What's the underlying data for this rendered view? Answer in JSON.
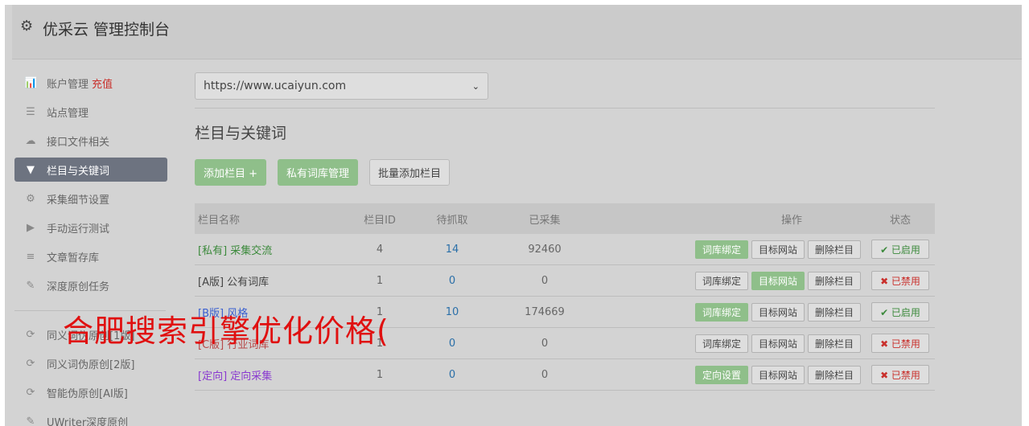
{
  "header": {
    "title": "优采云 管理控制台",
    "icon": "gear-icon"
  },
  "sidebar": {
    "items": [
      {
        "label": "账户管理",
        "extra": "充值",
        "icon": "bar-chart-icon",
        "glyph": "📊"
      },
      {
        "label": "站点管理",
        "icon": "server-icon",
        "glyph": "☰"
      },
      {
        "label": "接口文件相关",
        "icon": "cloud-upload-icon",
        "glyph": "☁"
      },
      {
        "label": "栏目与关键词",
        "icon": "filter-icon",
        "glyph": "▼",
        "active": true
      },
      {
        "label": "采集细节设置",
        "icon": "cogs-icon",
        "glyph": "⚙"
      },
      {
        "label": "手动运行测试",
        "icon": "play-circle-icon",
        "glyph": "▶"
      },
      {
        "label": "文章暂存库",
        "icon": "database-icon",
        "glyph": "≡"
      },
      {
        "label": "深度原创任务",
        "icon": "edit-icon",
        "glyph": "✎"
      }
    ],
    "items2": [
      {
        "label": "同义词伪原创[1版]",
        "icon": "refresh-icon",
        "glyph": "⟳"
      },
      {
        "label": "同义词伪原创[2版]",
        "icon": "refresh-icon",
        "glyph": "⟳"
      },
      {
        "label": "智能伪原创[AI版]",
        "icon": "refresh-icon",
        "glyph": "⟳"
      },
      {
        "label": "UWriter深度原创",
        "icon": "edit-icon",
        "glyph": "✎"
      }
    ]
  },
  "main": {
    "site_select": {
      "value": "https://www.ucaiyun.com",
      "caret": "⌄"
    },
    "section_title": "栏目与关键词",
    "buttons": {
      "add_column": "添加栏目 +",
      "private_dict": "私有词库管理",
      "batch_add": "批量添加栏目"
    },
    "table": {
      "headers": {
        "name": "栏目名称",
        "id": "栏目ID",
        "pending": "待抓取",
        "collected": "已采集",
        "actions": "操作",
        "status": "状态"
      },
      "rows": [
        {
          "name": "[私有] 采集交流",
          "id": "4",
          "pending": "14",
          "collected": "92460",
          "a1": "词库绑定",
          "a2": "目标网站",
          "a3": "删除栏目",
          "a1_on": true,
          "a2_on": false,
          "status": "✔ 已启用",
          "status_ok": true,
          "name_color": "green"
        },
        {
          "name": "[A版] 公有词库",
          "id": "1",
          "pending": "0",
          "collected": "0",
          "a1": "词库绑定",
          "a2": "目标网站",
          "a3": "删除栏目",
          "a1_on": false,
          "a2_on": true,
          "status": "✖ 已禁用",
          "status_ok": false,
          "name_color": "dark"
        },
        {
          "name": "[B版] 风格",
          "id": "1",
          "pending": "10",
          "collected": "174669",
          "a1": "词库绑定",
          "a2": "目标网站",
          "a3": "删除栏目",
          "a1_on": true,
          "a2_on": false,
          "status": "✔ 已启用",
          "status_ok": true,
          "name_color": "blue"
        },
        {
          "name": "[C版] 行业词库",
          "id": "1",
          "pending": "0",
          "collected": "0",
          "a1": "词库绑定",
          "a2": "目标网站",
          "a3": "删除栏目",
          "a1_on": false,
          "a2_on": false,
          "status": "✖ 已禁用",
          "status_ok": false,
          "name_color": "red"
        },
        {
          "name": "[定向] 定向采集",
          "id": "1",
          "pending": "0",
          "collected": "0",
          "a1": "定向设置",
          "a2": "目标网站",
          "a3": "删除栏目",
          "a1_on": true,
          "a2_on": false,
          "status": "✖ 已禁用",
          "status_ok": false,
          "name_color": "purple"
        }
      ]
    }
  },
  "watermark": "合肥搜索引擎优化价格("
}
